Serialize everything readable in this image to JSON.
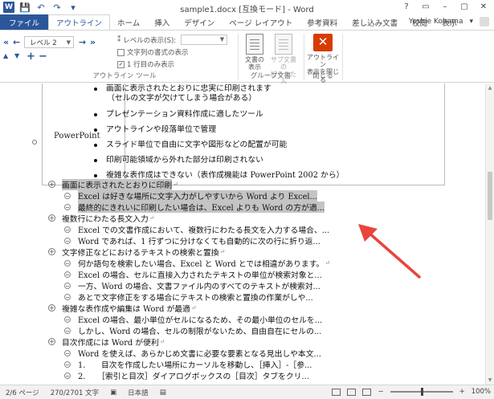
{
  "window": {
    "title": "sample1.docx [互換モード] - Word",
    "app_icon": "W",
    "controls": [
      "?",
      "▭",
      "–",
      "▢",
      "✕"
    ]
  },
  "qat": {
    "save": "💾",
    "undo": "↶",
    "redo": "↷",
    "more": "▾"
  },
  "tabs": [
    "ファイル",
    "アウトライン",
    "ホーム",
    "挿入",
    "デザイン",
    "ページ レイアウト",
    "参考資料",
    "差し込み文書",
    "校閲",
    "表示"
  ],
  "user": {
    "name": "Yoshie Kohama",
    "chevron": "▾"
  },
  "ribbon": {
    "level_value": "レベル 2",
    "show_level_label": "レベルの表示(S):",
    "show_format_label": "文字列の書式の表示",
    "first_line_label": "1 行目のみ表示",
    "outline_tools_label": "アウトライン ツール",
    "show_doc_label": "文書の\n表示",
    "collapse_sub_label": "サブ文書の\n折りたたみ",
    "master_group_label": "グループ文書",
    "close_outline_label": "アウトライン\n表示を閉じる",
    "close_group_label": "閉じる",
    "arrow_symbols": {
      "promote_top": "«",
      "promote": "←",
      "demote": "→",
      "demote_body": "»",
      "up": "▲",
      "down": "▼",
      "expand": "+",
      "collapse": "−"
    }
  },
  "table": {
    "label": "PowerPoint",
    "lines": [
      "画面に表示されたとおりに忠実に印刷されます",
      "（セルの文字が欠けてしまう場合がある）",
      "プレゼンテーション資料作成に適したツール",
      "アウトラインや段落単位で管理",
      "スライド単位で自由に文字や図形などの配置が可能",
      "印刷可能領域から外れた部分は印刷されない",
      "複雑な表作成はできない（表作成機能は PowerPoint 2002 から）"
    ]
  },
  "outline": [
    {
      "level": 1,
      "text": "画面に表示されたとおりに印刷",
      "highlight": true
    },
    {
      "level": 2,
      "text": "Excel は好きな場所に文字入力がしやすいから Word より Excel...",
      "highlight": true
    },
    {
      "level": 2,
      "text": "最終的にきれいに印刷したい場合は、Excel よりも Word の方が適...",
      "highlight": true
    },
    {
      "level": 1,
      "text": "複数行にわたる長文入力",
      "highlight": false
    },
    {
      "level": 2,
      "text": "Excel での文書作成において、複数行にわたる長文を入力する場合、...",
      "highlight": false
    },
    {
      "level": 2,
      "text": "Word であれば、1 行ずつに分けなくても自動的に次の行に折り返...",
      "highlight": false
    },
    {
      "level": 1,
      "text": "文字修正などにおけるテキストの検索と置換",
      "highlight": false
    },
    {
      "level": 2,
      "text": "何か語句を検索したい場合、Excel と Word とでは相違があります。",
      "highlight": false
    },
    {
      "level": 2,
      "text": "Excel の場合、セルに直接入力されたテキストの単位が検索対象と...",
      "highlight": false
    },
    {
      "level": 2,
      "text": "一方、Word の場合、文書ファイル内のすべてのテキストが検索対...",
      "highlight": false
    },
    {
      "level": 2,
      "text": "あとで文字修正をする場合にテキストの検索と置換の作業がしや...",
      "highlight": false
    },
    {
      "level": 1,
      "text": "複雑な表作成や編集は Word が最適",
      "highlight": false
    },
    {
      "level": 2,
      "text": "Excel の場合、最小単位がセルになるため、その最小単位のセルを...",
      "highlight": false
    },
    {
      "level": 2,
      "text": "しかし、Word の場合、セルの制限がないため、自由自在にセルの...",
      "highlight": false
    },
    {
      "level": 1,
      "text": "目次作成には Word が便利",
      "highlight": false
    },
    {
      "level": 2,
      "text": "Word を使えば、あらかじめ文書に必要な要素となる見出しや本文...",
      "highlight": false
    },
    {
      "level": 2,
      "text": "1.　　目次を作成したい場所にカーソルを移動し、［挿入］-［参...",
      "highlight": false
    },
    {
      "level": 2,
      "text": "2.　　［索引と目次］ダイアログボックスの［目次］タブをクリ...",
      "highlight": false
    }
  ],
  "status": {
    "page": "2/6 ページ",
    "words": "270/2701 文字",
    "lang": "日本語",
    "zoom": "100%",
    "minus": "−",
    "plus": "+"
  },
  "colors": {
    "accent": "#2b579a",
    "arrow": "#e8453c",
    "close_button": "#d83b01"
  }
}
